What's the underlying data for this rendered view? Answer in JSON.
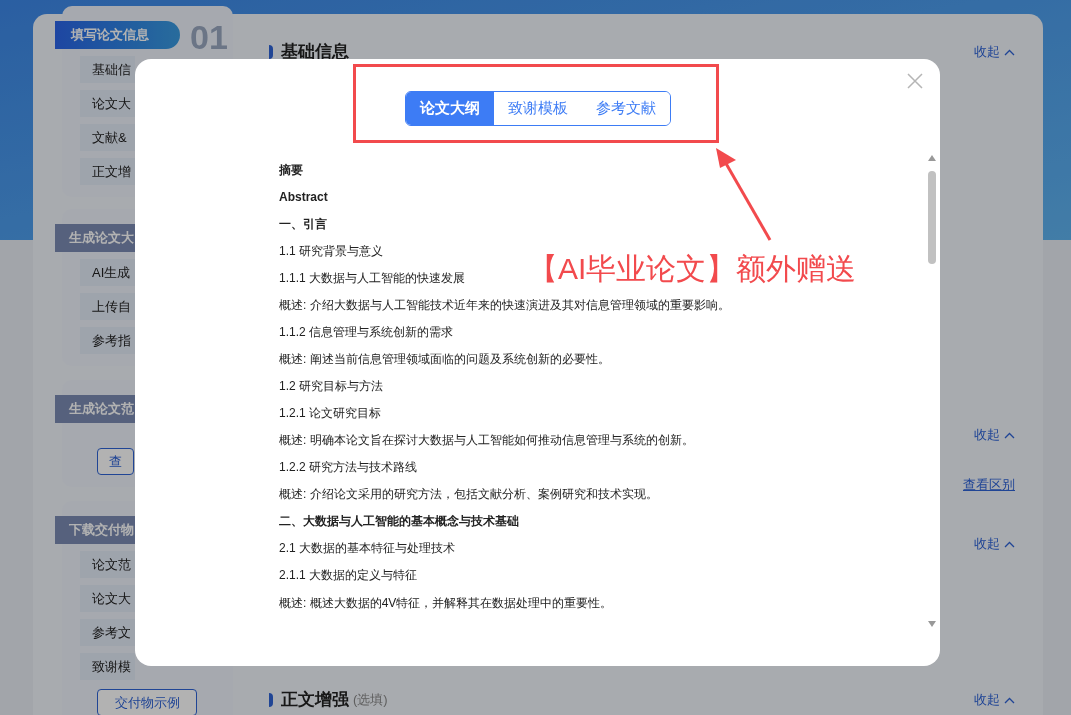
{
  "sidebar": [
    {
      "title": "填写论文信息",
      "active": true,
      "items": [
        "基础信",
        "论文大",
        "文献&",
        "正文增"
      ]
    },
    {
      "title": "生成论文大",
      "active": false,
      "items": [
        "AI生成",
        "上传自",
        "参考指"
      ]
    },
    {
      "title": "生成论文范",
      "active": false,
      "button": "查"
    },
    {
      "title": "下载交付物",
      "active": false,
      "items": [
        "论文范",
        "论文大",
        "参考文",
        "致谢模"
      ],
      "button": "交付物示例"
    }
  ],
  "step_number": "01",
  "sections": [
    {
      "kind": "heading",
      "title": "基础信息",
      "toggle": "收起"
    },
    {
      "kind": "toggle",
      "toggle": "收起"
    },
    {
      "kind": "link",
      "link": "查看区别"
    },
    {
      "kind": "toggle",
      "toggle": "收起"
    },
    {
      "kind": "heading",
      "title": "正文增强",
      "note": "(选填)",
      "toggle": "收起"
    }
  ],
  "modal": {
    "tabs": [
      {
        "label": "论文大纲",
        "selected": true
      },
      {
        "label": "致谢模板",
        "selected": false
      },
      {
        "label": "参考文献",
        "selected": false
      }
    ],
    "outline": [
      {
        "text": "摘要",
        "bold": true
      },
      {
        "text": "Abstract",
        "bold": true
      },
      {
        "text": "一、引言",
        "bold": true
      },
      {
        "text": "1.1 研究背景与意义",
        "bold": false
      },
      {
        "text": "1.1.1 大数据与人工智能的快速发展",
        "bold": false
      },
      {
        "text": "概述: 介绍大数据与人工智能技术近年来的快速演进及其对信息管理领域的重要影响。",
        "bold": false
      },
      {
        "text": "1.1.2 信息管理与系统创新的需求",
        "bold": false
      },
      {
        "text": "概述: 阐述当前信息管理领域面临的问题及系统创新的必要性。",
        "bold": false
      },
      {
        "text": "1.2 研究目标与方法",
        "bold": false
      },
      {
        "text": "1.2.1 论文研究目标",
        "bold": false
      },
      {
        "text": "概述: 明确本论文旨在探讨大数据与人工智能如何推动信息管理与系统的创新。",
        "bold": false
      },
      {
        "text": "1.2.2 研究方法与技术路线",
        "bold": false
      },
      {
        "text": "概述: 介绍论文采用的研究方法，包括文献分析、案例研究和技术实现。",
        "bold": false
      },
      {
        "text": "二、大数据与人工智能的基本概念与技术基础",
        "bold": true
      },
      {
        "text": "2.1 大数据的基本特征与处理技术",
        "bold": false
      },
      {
        "text": "2.1.1 大数据的定义与特征",
        "bold": false
      },
      {
        "text": "概述: 概述大数据的4V特征，并解释其在数据处理中的重要性。",
        "bold": false
      }
    ]
  },
  "annotation": {
    "text": "【AI毕业论文】额外赠送"
  }
}
